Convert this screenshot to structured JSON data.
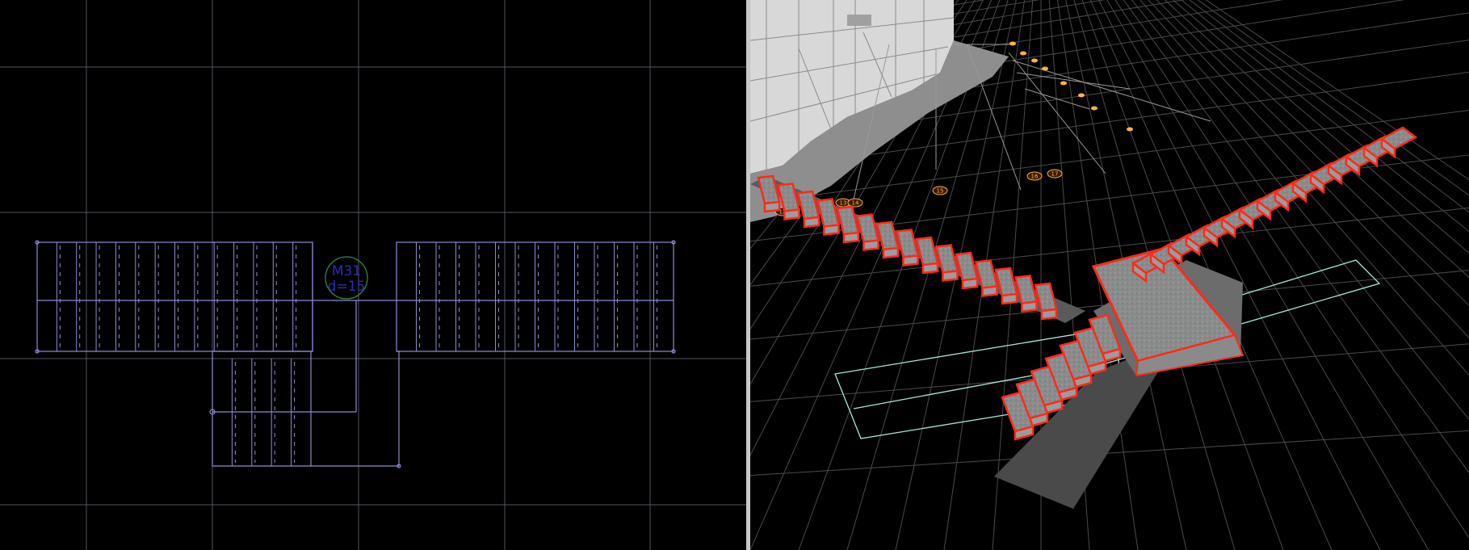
{
  "plan_view": {
    "stair_tag": {
      "mark": "M31",
      "diameter": "d=15"
    }
  },
  "view_3d": {
    "axis_labels": [
      "12",
      "13",
      "14",
      "15",
      "16",
      "17"
    ]
  },
  "colors": {
    "background": "#000000",
    "plan_grid": "#55555f",
    "plan_stair_outline": "#8c8cd2",
    "column_circle": "#2e8b3a",
    "tag_text": "#2b2fb5",
    "viewport_divider": "#c8c8c8",
    "grid_3d": "#4a4a4a",
    "stair_highlight": "#ff2a1a",
    "tread_fill": "#8a8c8c",
    "building": "#d6d6d6",
    "axis_marker": "#ffb347"
  }
}
